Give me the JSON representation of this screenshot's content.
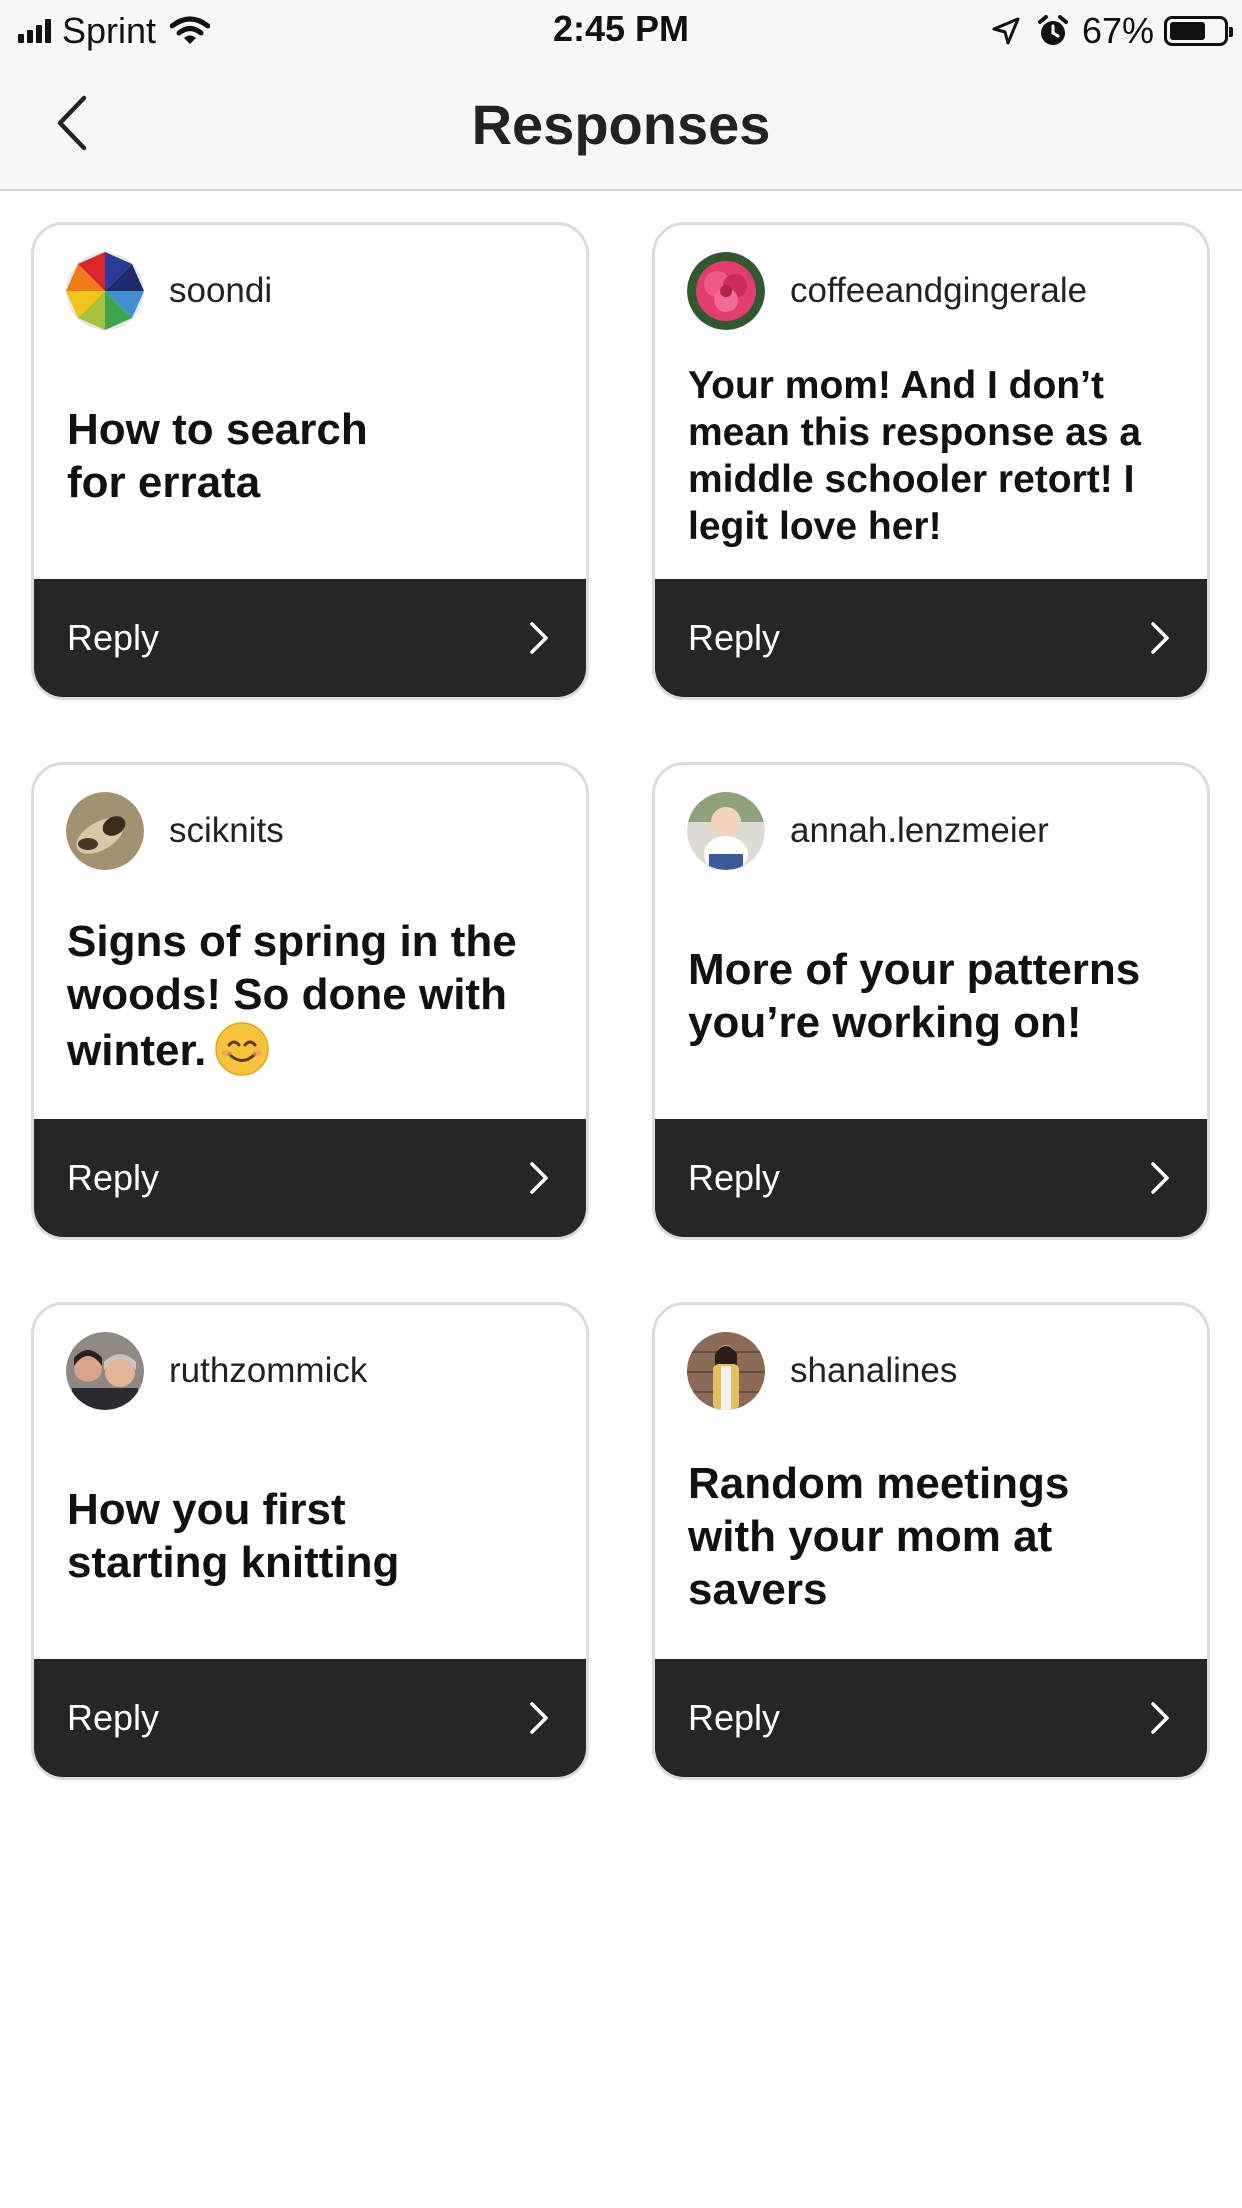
{
  "status_bar": {
    "carrier": "Sprint",
    "time": "2:45 PM",
    "battery_percent": "67%",
    "battery_level": 0.67
  },
  "nav": {
    "title": "Responses"
  },
  "cards": [
    {
      "username": "soondi",
      "prompt": "How to search for errata",
      "reply_label": "Reply"
    },
    {
      "username": "coffeeandgingerale",
      "prompt": "Your mom! And I don’t mean this response as a middle schooler retort! I legit love her!",
      "reply_label": "Reply"
    },
    {
      "username": "sciknits",
      "prompt": "Signs of spring in the woods!  So done with winter.",
      "reply_label": "Reply"
    },
    {
      "username": "annah.lenzmeier",
      "prompt": "More of your patterns you’re working on!",
      "reply_label": "Reply"
    },
    {
      "username": "ruthzommick",
      "prompt": "How you first starting knitting",
      "reply_label": "Reply"
    },
    {
      "username": "shanalines",
      "prompt": "Random meetings with your mom at savers",
      "reply_label": "Reply"
    }
  ],
  "icons": {
    "back": "chevron-left-icon",
    "reply_arrow": "chevron-right-icon",
    "signal": "signal-bars-icon",
    "wifi": "wifi-icon",
    "location": "location-arrow-icon",
    "alarm": "alarm-clock-icon",
    "battery": "battery-icon",
    "emoji": "smiling-face-icon"
  }
}
